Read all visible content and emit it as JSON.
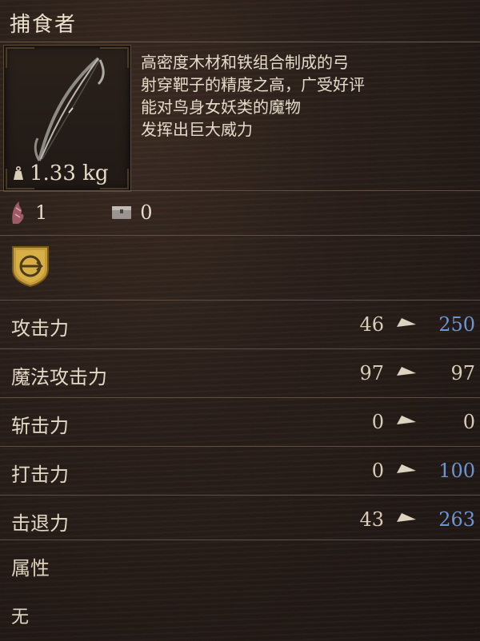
{
  "item": {
    "name": "捕食者",
    "weight": "1.33 kg",
    "description": [
      "高密度木材和铁组合制成的弓",
      "射穿靶子的精度之高，广受好评",
      "能对鸟身女妖类的魔物",
      "发挥出巨大威力"
    ]
  },
  "requirements": {
    "strength_value": "1",
    "slots_value": "0",
    "strength_icon": "claw-icon",
    "slots_icon": "chest-icon"
  },
  "weapon_type_icon": "bow-class-icon",
  "stats": [
    {
      "label": "攻击力",
      "base": "46",
      "new": "250",
      "highlight": true
    },
    {
      "label": "魔法攻击力",
      "base": "97",
      "new": "97",
      "highlight": false
    },
    {
      "label": "斩击力",
      "base": "0",
      "new": "0",
      "highlight": false
    },
    {
      "label": "打击力",
      "base": "0",
      "new": "100",
      "highlight": true
    },
    {
      "label": "击退力",
      "base": "43",
      "new": "263",
      "highlight": true
    }
  ],
  "attribute": {
    "label": "属性",
    "value": "无"
  },
  "colors": {
    "highlight": "#6f94cf",
    "normal": "#d8ccb7",
    "gold": "#c59a3a",
    "crest_red": "#8b2f2f"
  }
}
